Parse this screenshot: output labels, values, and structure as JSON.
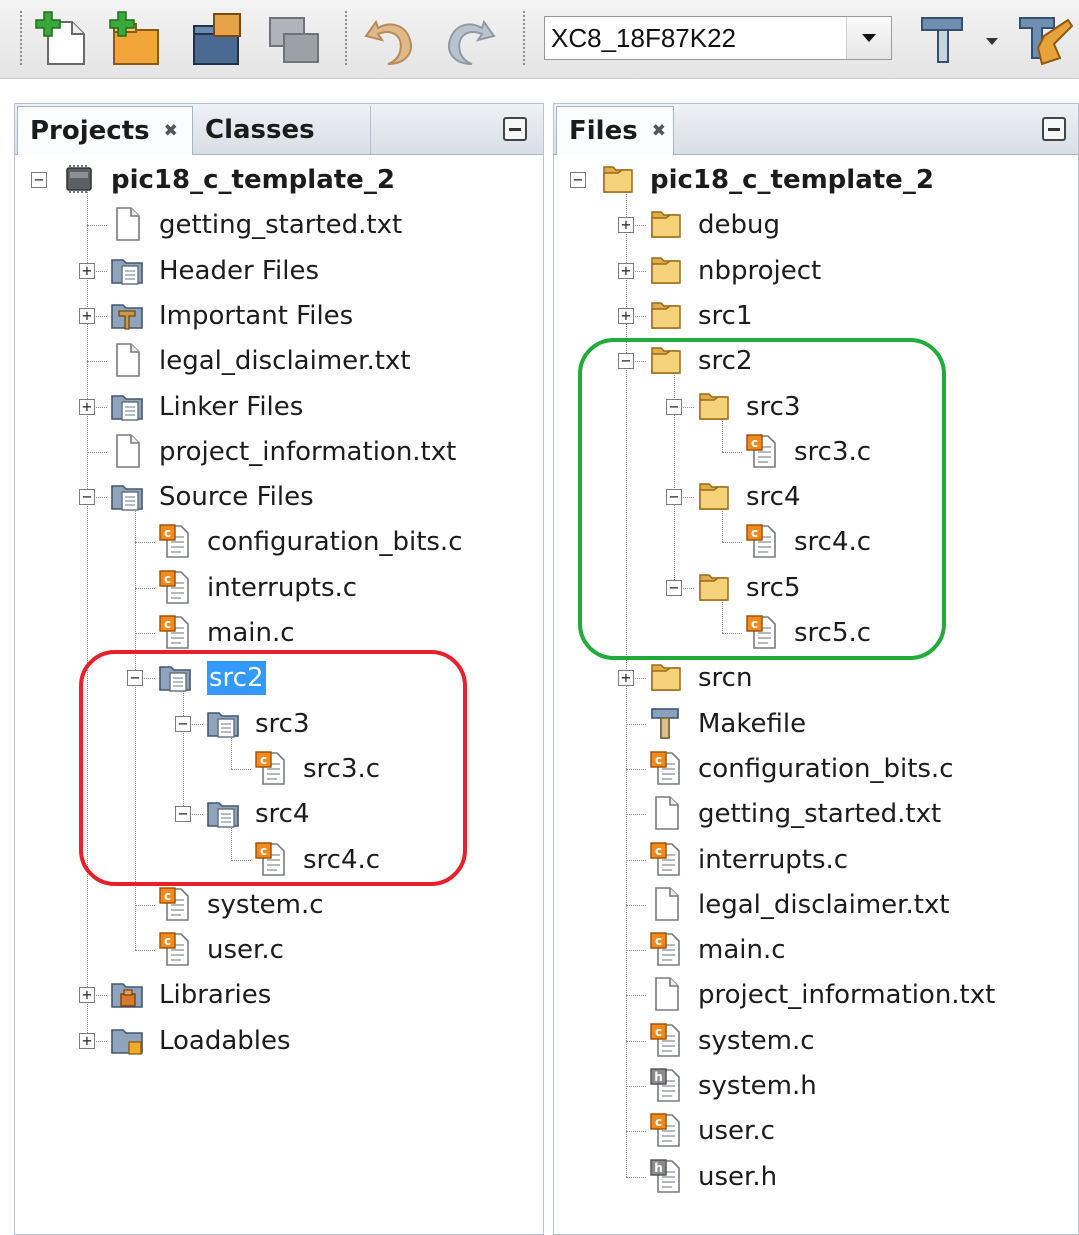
{
  "toolbar": {
    "icons": [
      "new-file-icon",
      "new-project-icon",
      "open-project-icon",
      "close-project-icon",
      "undo-icon",
      "redo-icon",
      "build-icon",
      "dropdown-arrow-icon",
      "clean-build-icon"
    ],
    "configuration": "XC8_18F87K22"
  },
  "left_panel": {
    "tabs": [
      {
        "label": "Projects",
        "closable": true,
        "active": true
      },
      {
        "label": "Classes",
        "closable": false,
        "active": false
      }
    ],
    "root": "pic18_c_template_2",
    "nodes": [
      {
        "label": "getting_started.txt",
        "icon": "text-file-icon",
        "depth": 1
      },
      {
        "label": "Header Files",
        "icon": "logical-folder-icon",
        "depth": 1,
        "expandable": true,
        "expanded": false
      },
      {
        "label": "Important Files",
        "icon": "important-folder-icon",
        "depth": 1,
        "expandable": true,
        "expanded": false
      },
      {
        "label": "legal_disclaimer.txt",
        "icon": "text-file-icon",
        "depth": 1
      },
      {
        "label": "Linker Files",
        "icon": "logical-folder-icon",
        "depth": 1,
        "expandable": true,
        "expanded": false
      },
      {
        "label": "project_information.txt",
        "icon": "text-file-icon",
        "depth": 1
      },
      {
        "label": "Source Files",
        "icon": "logical-folder-icon",
        "depth": 1,
        "expandable": true,
        "expanded": true
      },
      {
        "label": "configuration_bits.c",
        "icon": "c-file-icon",
        "depth": 2
      },
      {
        "label": "interrupts.c",
        "icon": "c-file-icon",
        "depth": 2
      },
      {
        "label": "main.c",
        "icon": "c-file-icon",
        "depth": 2
      },
      {
        "label": "src2",
        "icon": "logical-folder-icon",
        "depth": 2,
        "expandable": true,
        "expanded": true,
        "selected": true
      },
      {
        "label": "src3",
        "icon": "logical-folder-icon",
        "depth": 3,
        "expandable": true,
        "expanded": true
      },
      {
        "label": "src3.c",
        "icon": "c-file-icon",
        "depth": 4
      },
      {
        "label": "src4",
        "icon": "logical-folder-icon",
        "depth": 3,
        "expandable": true,
        "expanded": true
      },
      {
        "label": "src4.c",
        "icon": "c-file-icon",
        "depth": 4
      },
      {
        "label": "system.c",
        "icon": "c-file-icon",
        "depth": 2
      },
      {
        "label": "user.c",
        "icon": "c-file-icon",
        "depth": 2
      },
      {
        "label": "Libraries",
        "icon": "libraries-folder-icon",
        "depth": 1,
        "expandable": true,
        "expanded": false
      },
      {
        "label": "Loadables",
        "icon": "loadables-folder-icon",
        "depth": 1,
        "expandable": true,
        "expanded": false
      }
    ],
    "highlight_color": "#e8202a"
  },
  "right_panel": {
    "tabs": [
      {
        "label": "Files",
        "closable": true,
        "active": true
      }
    ],
    "root": "pic18_c_template_2",
    "nodes": [
      {
        "label": "debug",
        "icon": "folder-icon",
        "depth": 1,
        "expandable": true,
        "expanded": false
      },
      {
        "label": "nbproject",
        "icon": "folder-icon",
        "depth": 1,
        "expandable": true,
        "expanded": false
      },
      {
        "label": "src1",
        "icon": "folder-icon",
        "depth": 1,
        "expandable": true,
        "expanded": false
      },
      {
        "label": "src2",
        "icon": "folder-icon",
        "depth": 1,
        "expandable": true,
        "expanded": true
      },
      {
        "label": "src3",
        "icon": "folder-icon",
        "depth": 2,
        "expandable": true,
        "expanded": true
      },
      {
        "label": "src3.c",
        "icon": "c-file-icon",
        "depth": 3
      },
      {
        "label": "src4",
        "icon": "folder-icon",
        "depth": 2,
        "expandable": true,
        "expanded": true
      },
      {
        "label": "src4.c",
        "icon": "c-file-icon",
        "depth": 3
      },
      {
        "label": "src5",
        "icon": "folder-icon",
        "depth": 2,
        "expandable": true,
        "expanded": true
      },
      {
        "label": "src5.c",
        "icon": "c-file-icon",
        "depth": 3
      },
      {
        "label": "srcn",
        "icon": "folder-icon",
        "depth": 1,
        "expandable": true,
        "expanded": false
      },
      {
        "label": "Makefile",
        "icon": "makefile-icon",
        "depth": 1
      },
      {
        "label": "configuration_bits.c",
        "icon": "c-file-icon",
        "depth": 1
      },
      {
        "label": "getting_started.txt",
        "icon": "text-file-icon",
        "depth": 1
      },
      {
        "label": "interrupts.c",
        "icon": "c-file-icon",
        "depth": 1
      },
      {
        "label": "legal_disclaimer.txt",
        "icon": "text-file-icon",
        "depth": 1
      },
      {
        "label": "main.c",
        "icon": "c-file-icon",
        "depth": 1
      },
      {
        "label": "project_information.txt",
        "icon": "text-file-icon",
        "depth": 1
      },
      {
        "label": "system.c",
        "icon": "c-file-icon",
        "depth": 1
      },
      {
        "label": "system.h",
        "icon": "h-file-icon",
        "depth": 1
      },
      {
        "label": "user.c",
        "icon": "c-file-icon",
        "depth": 1
      },
      {
        "label": "user.h",
        "icon": "h-file-icon",
        "depth": 1
      }
    ],
    "highlight_color": "#22aa3a"
  }
}
